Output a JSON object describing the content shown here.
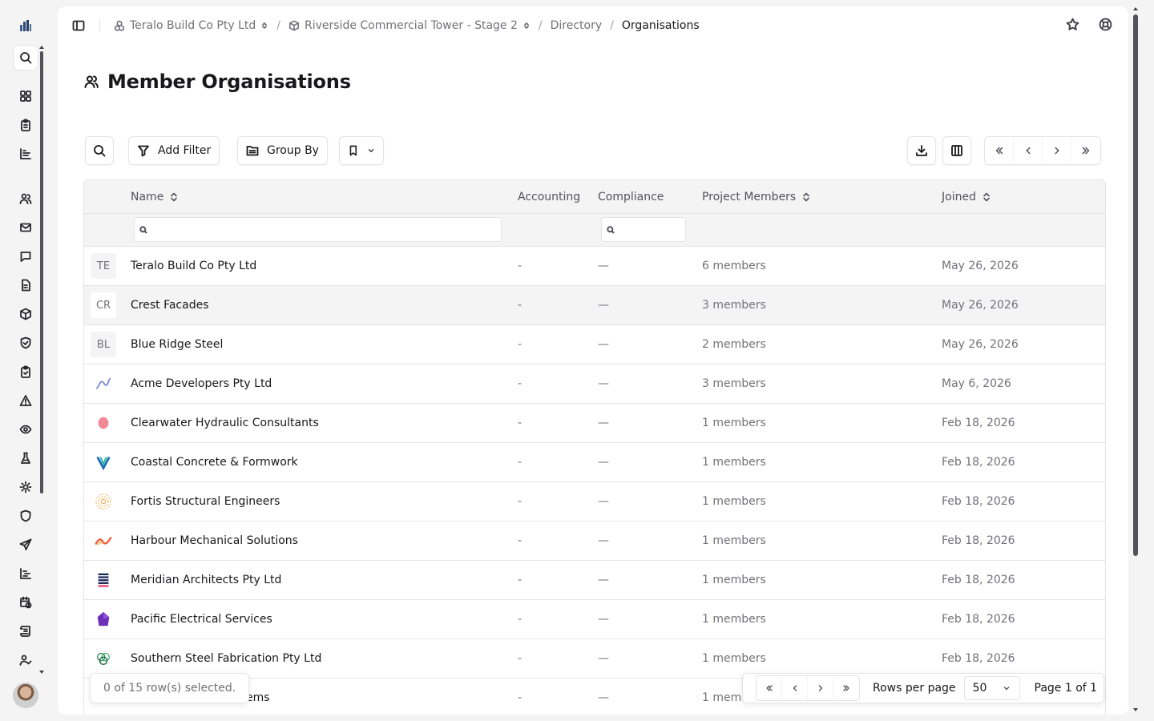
{
  "breadcrumb": {
    "org": "Teralo Build Co Pty Ltd",
    "project": "Riverside Commercial Tower - Stage 2",
    "section": "Directory",
    "current": "Organisations"
  },
  "page": {
    "title": "Member Organisations"
  },
  "toolbar": {
    "add_filter": "Add Filter",
    "group_by": "Group By"
  },
  "table": {
    "columns": {
      "name": "Name",
      "accounting": "Accounting",
      "compliance": "Compliance",
      "members": "Project Members",
      "joined": "Joined"
    },
    "rows": [
      {
        "logo_text": "TE",
        "logo": "initials",
        "name": "Teralo Build Co Pty Ltd",
        "accounting": "-",
        "compliance": "—",
        "members": "6 members",
        "joined": "May 26, 2026"
      },
      {
        "logo_text": "CR",
        "logo": "initials",
        "name": "Crest Facades",
        "accounting": "-",
        "compliance": "—",
        "members": "3 members",
        "joined": "May 26, 2026"
      },
      {
        "logo_text": "BL",
        "logo": "initials",
        "name": "Blue Ridge Steel",
        "accounting": "-",
        "compliance": "—",
        "members": "2 members",
        "joined": "May 26, 2026"
      },
      {
        "logo_text": "",
        "logo": "wave-purple-icon",
        "name": "Acme Developers Pty Ltd",
        "accounting": "-",
        "compliance": "—",
        "members": "3 members",
        "joined": "May 6, 2026"
      },
      {
        "logo_text": "",
        "logo": "pink-blob-icon",
        "name": "Clearwater Hydraulic Consultants",
        "accounting": "-",
        "compliance": "—",
        "members": "1 members",
        "joined": "Feb 18, 2026"
      },
      {
        "logo_text": "",
        "logo": "teal-v-icon",
        "name": "Coastal Concrete & Formwork",
        "accounting": "-",
        "compliance": "—",
        "members": "1 members",
        "joined": "Feb 18, 2026"
      },
      {
        "logo_text": "",
        "logo": "concentric-rings-icon",
        "name": "Fortis Structural Engineers",
        "accounting": "-",
        "compliance": "—",
        "members": "1 members",
        "joined": "Feb 18, 2026"
      },
      {
        "logo_text": "",
        "logo": "orange-wave-icon",
        "name": "Harbour Mechanical Solutions",
        "accounting": "-",
        "compliance": "—",
        "members": "1 members",
        "joined": "Feb 18, 2026"
      },
      {
        "logo_text": "",
        "logo": "stacked-bars-icon",
        "name": "Meridian Architects Pty Ltd",
        "accounting": "-",
        "compliance": "—",
        "members": "1 members",
        "joined": "Feb 18, 2026"
      },
      {
        "logo_text": "",
        "logo": "purple-gem-icon",
        "name": "Pacific Electrical Services",
        "accounting": "-",
        "compliance": "—",
        "members": "1 members",
        "joined": "Feb 18, 2026"
      },
      {
        "logo_text": "",
        "logo": "green-rings-icon",
        "name": "Southern Steel Fabrication Pty Ltd",
        "accounting": "-",
        "compliance": "—",
        "members": "1 members",
        "joined": "Feb 18, 2026"
      },
      {
        "logo_text": "",
        "logo": "partial-icon",
        "name": "ems",
        "accounting": "-",
        "compliance": "—",
        "members": "1 mem",
        "joined": ""
      }
    ]
  },
  "footer": {
    "selection": "0 of 15 row(s) selected.",
    "rows_per_page_label": "Rows per page",
    "rows_per_page_value": "50",
    "page_of": "Page 1 of 1"
  }
}
